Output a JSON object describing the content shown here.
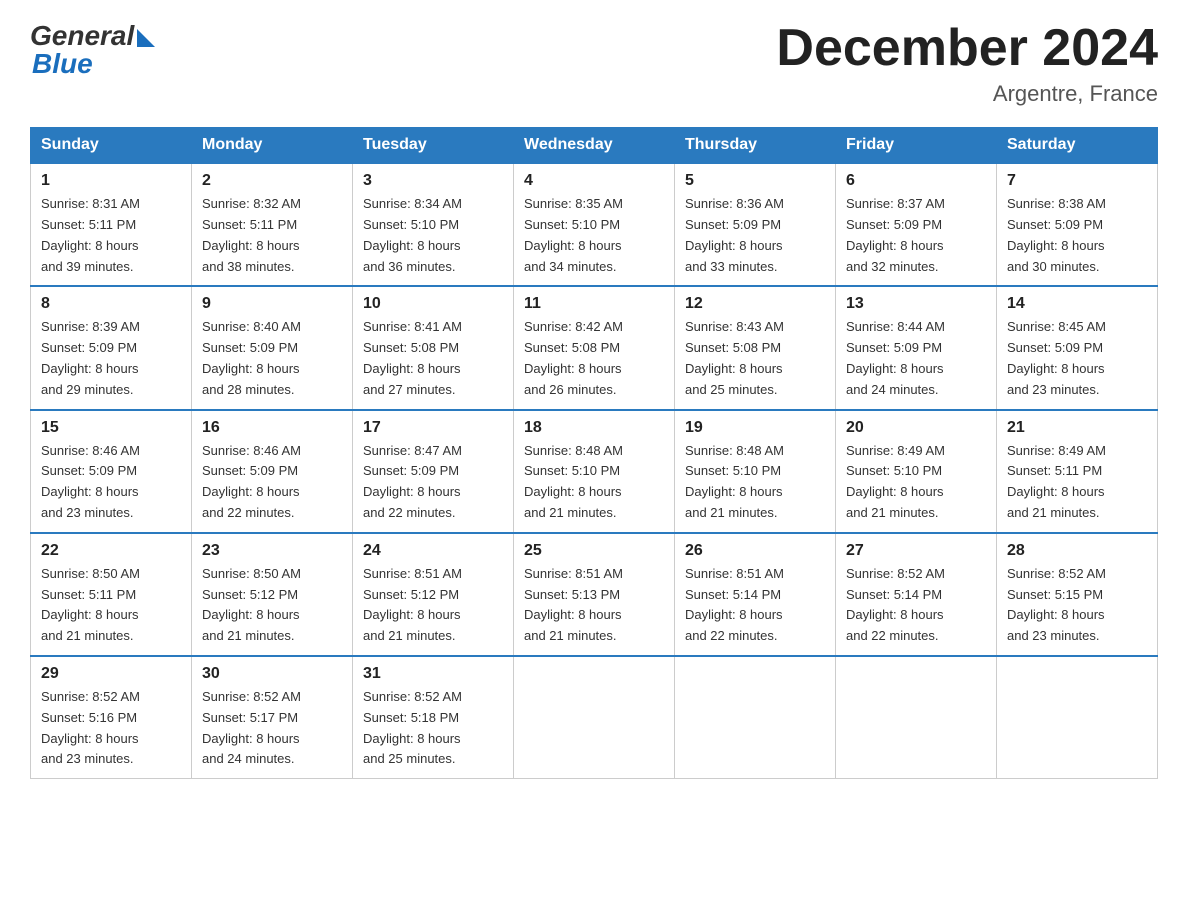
{
  "header": {
    "logo_general": "General",
    "logo_blue": "Blue",
    "month_title": "December 2024",
    "location": "Argentre, France"
  },
  "days_of_week": [
    "Sunday",
    "Monday",
    "Tuesday",
    "Wednesday",
    "Thursday",
    "Friday",
    "Saturday"
  ],
  "weeks": [
    [
      {
        "day": "1",
        "sunrise": "8:31 AM",
        "sunset": "5:11 PM",
        "daylight": "8 hours and 39 minutes."
      },
      {
        "day": "2",
        "sunrise": "8:32 AM",
        "sunset": "5:11 PM",
        "daylight": "8 hours and 38 minutes."
      },
      {
        "day": "3",
        "sunrise": "8:34 AM",
        "sunset": "5:10 PM",
        "daylight": "8 hours and 36 minutes."
      },
      {
        "day": "4",
        "sunrise": "8:35 AM",
        "sunset": "5:10 PM",
        "daylight": "8 hours and 34 minutes."
      },
      {
        "day": "5",
        "sunrise": "8:36 AM",
        "sunset": "5:09 PM",
        "daylight": "8 hours and 33 minutes."
      },
      {
        "day": "6",
        "sunrise": "8:37 AM",
        "sunset": "5:09 PM",
        "daylight": "8 hours and 32 minutes."
      },
      {
        "day": "7",
        "sunrise": "8:38 AM",
        "sunset": "5:09 PM",
        "daylight": "8 hours and 30 minutes."
      }
    ],
    [
      {
        "day": "8",
        "sunrise": "8:39 AM",
        "sunset": "5:09 PM",
        "daylight": "8 hours and 29 minutes."
      },
      {
        "day": "9",
        "sunrise": "8:40 AM",
        "sunset": "5:09 PM",
        "daylight": "8 hours and 28 minutes."
      },
      {
        "day": "10",
        "sunrise": "8:41 AM",
        "sunset": "5:08 PM",
        "daylight": "8 hours and 27 minutes."
      },
      {
        "day": "11",
        "sunrise": "8:42 AM",
        "sunset": "5:08 PM",
        "daylight": "8 hours and 26 minutes."
      },
      {
        "day": "12",
        "sunrise": "8:43 AM",
        "sunset": "5:08 PM",
        "daylight": "8 hours and 25 minutes."
      },
      {
        "day": "13",
        "sunrise": "8:44 AM",
        "sunset": "5:09 PM",
        "daylight": "8 hours and 24 minutes."
      },
      {
        "day": "14",
        "sunrise": "8:45 AM",
        "sunset": "5:09 PM",
        "daylight": "8 hours and 23 minutes."
      }
    ],
    [
      {
        "day": "15",
        "sunrise": "8:46 AM",
        "sunset": "5:09 PM",
        "daylight": "8 hours and 23 minutes."
      },
      {
        "day": "16",
        "sunrise": "8:46 AM",
        "sunset": "5:09 PM",
        "daylight": "8 hours and 22 minutes."
      },
      {
        "day": "17",
        "sunrise": "8:47 AM",
        "sunset": "5:09 PM",
        "daylight": "8 hours and 22 minutes."
      },
      {
        "day": "18",
        "sunrise": "8:48 AM",
        "sunset": "5:10 PM",
        "daylight": "8 hours and 21 minutes."
      },
      {
        "day": "19",
        "sunrise": "8:48 AM",
        "sunset": "5:10 PM",
        "daylight": "8 hours and 21 minutes."
      },
      {
        "day": "20",
        "sunrise": "8:49 AM",
        "sunset": "5:10 PM",
        "daylight": "8 hours and 21 minutes."
      },
      {
        "day": "21",
        "sunrise": "8:49 AM",
        "sunset": "5:11 PM",
        "daylight": "8 hours and 21 minutes."
      }
    ],
    [
      {
        "day": "22",
        "sunrise": "8:50 AM",
        "sunset": "5:11 PM",
        "daylight": "8 hours and 21 minutes."
      },
      {
        "day": "23",
        "sunrise": "8:50 AM",
        "sunset": "5:12 PM",
        "daylight": "8 hours and 21 minutes."
      },
      {
        "day": "24",
        "sunrise": "8:51 AM",
        "sunset": "5:12 PM",
        "daylight": "8 hours and 21 minutes."
      },
      {
        "day": "25",
        "sunrise": "8:51 AM",
        "sunset": "5:13 PM",
        "daylight": "8 hours and 21 minutes."
      },
      {
        "day": "26",
        "sunrise": "8:51 AM",
        "sunset": "5:14 PM",
        "daylight": "8 hours and 22 minutes."
      },
      {
        "day": "27",
        "sunrise": "8:52 AM",
        "sunset": "5:14 PM",
        "daylight": "8 hours and 22 minutes."
      },
      {
        "day": "28",
        "sunrise": "8:52 AM",
        "sunset": "5:15 PM",
        "daylight": "8 hours and 23 minutes."
      }
    ],
    [
      {
        "day": "29",
        "sunrise": "8:52 AM",
        "sunset": "5:16 PM",
        "daylight": "8 hours and 23 minutes."
      },
      {
        "day": "30",
        "sunrise": "8:52 AM",
        "sunset": "5:17 PM",
        "daylight": "8 hours and 24 minutes."
      },
      {
        "day": "31",
        "sunrise": "8:52 AM",
        "sunset": "5:18 PM",
        "daylight": "8 hours and 25 minutes."
      },
      null,
      null,
      null,
      null
    ]
  ],
  "labels": {
    "sunrise_prefix": "Sunrise: ",
    "sunset_prefix": "Sunset: ",
    "daylight_prefix": "Daylight: "
  }
}
